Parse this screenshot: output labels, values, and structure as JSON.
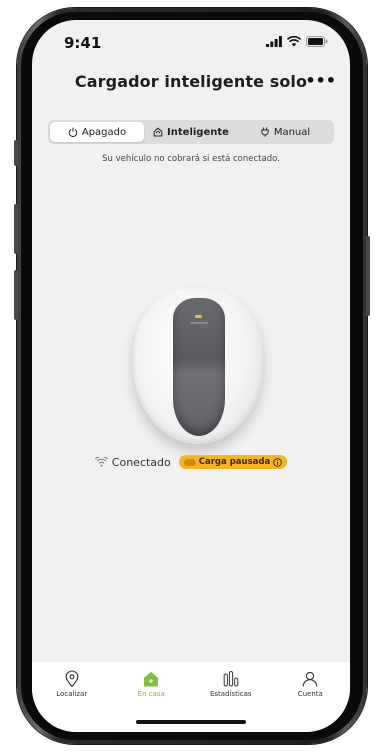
{
  "status_bar": {
    "time": "9:41"
  },
  "header": {
    "title": "Cargador inteligente solo",
    "more_label": "•••"
  },
  "modes": [
    {
      "label": "Apagado",
      "icon": "power-icon"
    },
    {
      "label": "Inteligente",
      "icon": "home-icon"
    },
    {
      "label": "Manual",
      "icon": "plug-icon"
    }
  ],
  "selected_mode": "Apagado",
  "hint": "Su vehículo no cobrará si está conectado.",
  "connection": {
    "status_label": "Conectado",
    "badge_label": "Carga pausada"
  },
  "tabs": [
    {
      "label": "Localizar",
      "icon": "location-pin-icon"
    },
    {
      "label": "En casa",
      "icon": "home-filled-icon"
    },
    {
      "label": "Estadísticas",
      "icon": "stats-bars-icon"
    },
    {
      "label": "Cuenta",
      "icon": "user-icon"
    }
  ],
  "active_tab": "En casa",
  "colors": {
    "accent": "#7fbf3a",
    "badge": "#f6b324",
    "background": "#f1f1f2"
  }
}
